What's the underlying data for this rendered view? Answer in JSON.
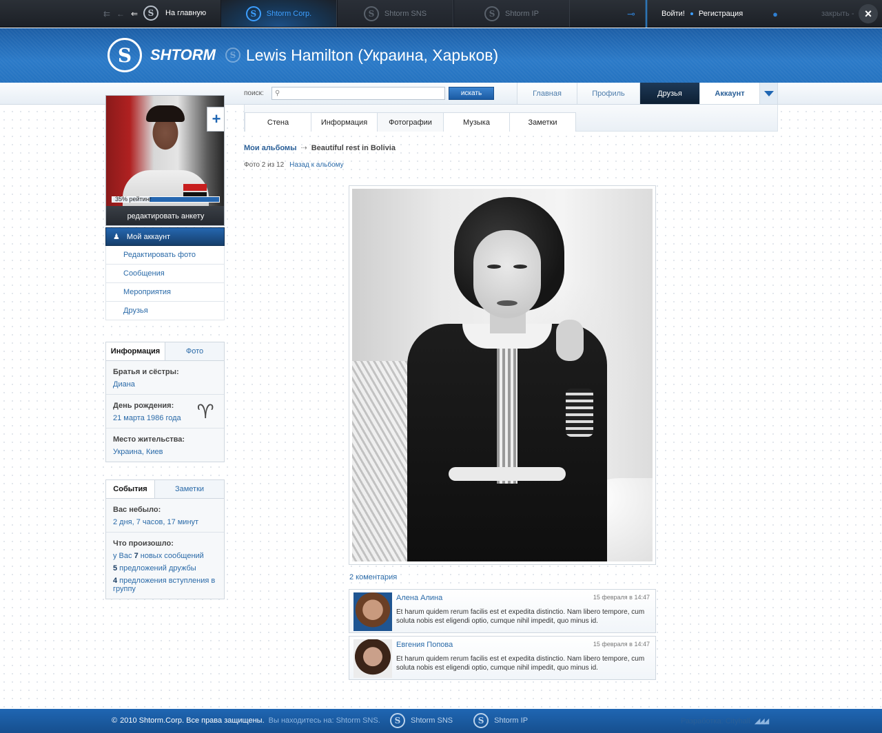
{
  "topbar": {
    "home_label": "На главную",
    "tabs": [
      {
        "label": "Shtorm Corp.",
        "active": true
      },
      {
        "label": "Shtorm SNS",
        "active": false
      },
      {
        "label": "Shtorm IP",
        "active": false
      }
    ],
    "login_label": "Войти!",
    "register_label": "Регистрация",
    "close_label": "закрыть -",
    "close_icon": "×"
  },
  "header": {
    "brand_text": "SHTORM",
    "profile_title": "Lewis Hamilton (Украина, Харьков)"
  },
  "search": {
    "label": "поиск:",
    "placeholder": "",
    "button_label": "искать"
  },
  "main_tabs": [
    {
      "label": "Главная",
      "state": "normal"
    },
    {
      "label": "Профиль",
      "state": "normal"
    },
    {
      "label": "Друзья",
      "state": "active"
    },
    {
      "label": "Аккаунт",
      "state": "bold"
    }
  ],
  "sidebar": {
    "rating_text": "35% рейтинг",
    "rating_value": 0.35,
    "edit_profile_label": "редактировать анкету",
    "menu": [
      {
        "label": "Мой аккаунт",
        "active": true
      },
      {
        "label": "Редактировать фото",
        "active": false
      },
      {
        "label": "Сообщения",
        "active": false
      },
      {
        "label": "Мероприятия",
        "active": false
      },
      {
        "label": "Друзья",
        "active": false
      }
    ],
    "info_tabs": [
      "Информация",
      "Фото"
    ],
    "info": [
      {
        "label": "Братья и сёстры:",
        "value": "Диана"
      },
      {
        "label": "День рождения:",
        "value": "21 марта 1986 года"
      },
      {
        "label": "Место жительства:",
        "value": "Украина, Киев"
      }
    ],
    "event_tabs": [
      "События",
      "Заметки"
    ],
    "events": {
      "absent_label": "Вас небыло:",
      "absent_value": "2 дня, 7 часов, 17 минут",
      "happened_label": "Что произошло:",
      "line1_pre": "у Вас ",
      "line1_num": "7",
      "line1_post": " новых сообщений",
      "line2_num": "5",
      "line2_post": " предложений дружбы",
      "line3_num": "4",
      "line3_post": " предложения вступления в группу"
    }
  },
  "content": {
    "sub_tabs": [
      {
        "label": "Стена",
        "active": false
      },
      {
        "label": "Информация",
        "active": false
      },
      {
        "label": "Фотографии",
        "active": true
      },
      {
        "label": "Музыка",
        "active": false
      },
      {
        "label": "Заметки",
        "active": false
      }
    ],
    "breadcrumb": {
      "albums_label": "Мои альбомы",
      "current": "Beautiful rest in Bolivia"
    },
    "photo_counter": "Фото 2 из 12",
    "back_label": "Назад к альбому",
    "comments_count": "2 коментария",
    "comments": [
      {
        "author": "Алена Алина",
        "date": "15 февраля в 14:47",
        "text": "Et harum quidem rerum facilis est et expedita distinctio. Nam libero tempore, cum soluta nobis est eligendi optio, cumque nihil impedit, quo minus id."
      },
      {
        "author": "Евгения Попова",
        "date": "15 февраля в 14:47",
        "text": "Et harum quidem rerum facilis est et expedita distinctio. Nam libero tempore, cum soluta nobis est eligendi optio, cumque nihil impedit, quo minus id."
      }
    ]
  },
  "footer": {
    "copyright_symbol": "©",
    "copyright": "2010 Shtorm.Corp. Все права защищены.",
    "location": "Вы находитесь на: Shtorm SNS.",
    "links": [
      "Shtorm SNS",
      "Shtorm IP"
    ],
    "developer": "Разработка: Cityhall"
  },
  "colors": {
    "accent": "#1f66b3",
    "link": "#2a6aa8",
    "topbar": "#23282f",
    "active_tab_text": "#3d9fff"
  }
}
